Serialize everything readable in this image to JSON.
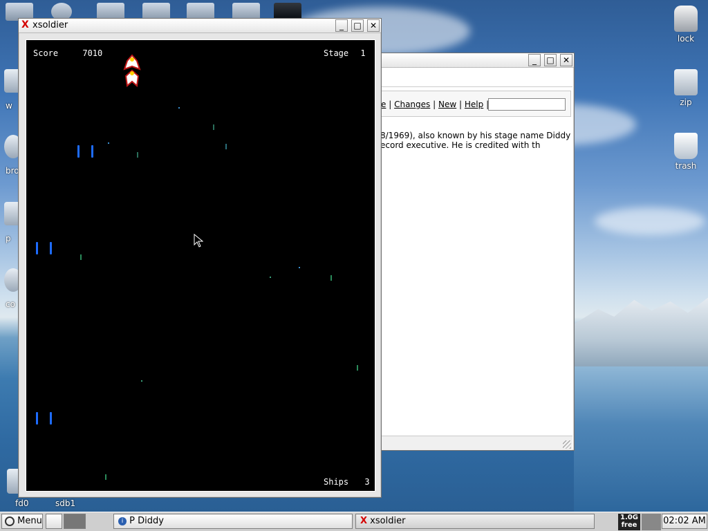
{
  "desktop": {
    "right_icons": [
      {
        "label": "lock",
        "icon": "lock-icon"
      },
      {
        "label": "zip",
        "icon": "zip-icon"
      },
      {
        "label": "trash",
        "icon": "trash-icon"
      }
    ],
    "left_labels": [
      "w",
      "bro",
      "p",
      "co"
    ],
    "bottom_labels": [
      "fd0",
      "sdb1"
    ]
  },
  "game_window": {
    "title": "xsoldier",
    "score_label": "Score",
    "score_value": "7010",
    "stage_label": "Stage",
    "stage_value": "1",
    "ships_label": "Ships",
    "ships_value": "3",
    "buttons": {
      "minimize": "_",
      "maximize": "□",
      "close": "✕"
    }
  },
  "browser_window": {
    "nav_links": [
      "e",
      "Changes",
      "New",
      "Help"
    ],
    "nav_separators": "|",
    "content_line1": "8/1969), also known by his stage name Diddy,",
    "content_line2": "ecord executive. He is credited with th",
    "buttons": {
      "minimize": "_",
      "maximize": "□",
      "close": "✕"
    }
  },
  "taskbar": {
    "menu_label": "Menu",
    "tasks": [
      {
        "label": "P Diddy",
        "icon": "info-icon"
      },
      {
        "label": "xsoldier",
        "icon": "x-logo-icon"
      }
    ],
    "disk_free_top": "1.0G",
    "disk_free_bottom": "free",
    "clock": "02:02 AM"
  },
  "colors": {
    "game_bg": "#000000",
    "laser": "#1e6cff",
    "xlogo": "#d40000"
  }
}
